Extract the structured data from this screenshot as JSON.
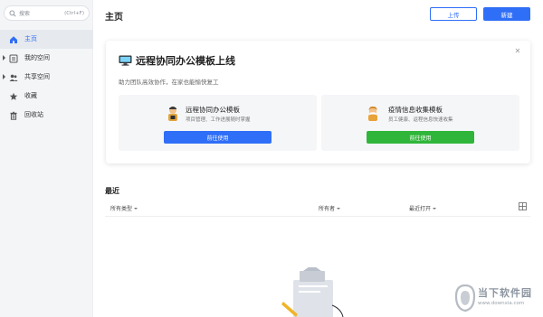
{
  "sidebar": {
    "search": {
      "placeholder": "搜索",
      "shortcut": "(Ctrl+F)"
    },
    "items": [
      {
        "label": "主页",
        "icon": "home-icon",
        "active": true
      },
      {
        "label": "我的空间",
        "icon": "my-space-icon",
        "expandable": true
      },
      {
        "label": "共享空间",
        "icon": "shared-space-icon",
        "expandable": true
      },
      {
        "label": "收藏",
        "icon": "star-icon"
      },
      {
        "label": "回收站",
        "icon": "trash-icon"
      }
    ]
  },
  "header": {
    "title": "主页",
    "upload_label": "上传",
    "new_label": "新建"
  },
  "banner": {
    "title": "远程协同办公模板上线",
    "subtitle": "助力团队高效协作，在家也能愉快复工",
    "templates": [
      {
        "name": "远程协同办公模板",
        "desc": "项目管理、工作进展随时掌握",
        "button": "前往使用",
        "color": "#2f6ef7"
      },
      {
        "name": "疫情信息收集模板",
        "desc": "员工健康、返程信息快速收集",
        "button": "前往使用",
        "color": "#2fb63a"
      }
    ]
  },
  "recent": {
    "title": "最近",
    "filters": {
      "type": "所有类型",
      "owner": "所有者",
      "opened": "最近打开"
    }
  },
  "watermark": {
    "name": "当下软件园",
    "url": "www.downxia.com"
  },
  "colors": {
    "accent": "#2f6ef7",
    "green": "#2fb63a"
  }
}
